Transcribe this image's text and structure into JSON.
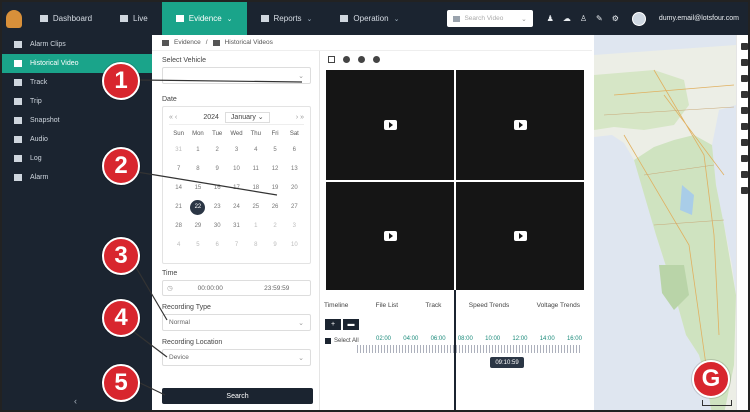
{
  "topbar": {
    "nav": [
      {
        "label": "Dashboard",
        "icon": "dashboard-icon",
        "active": false
      },
      {
        "label": "Live",
        "icon": "live-icon",
        "active": false
      },
      {
        "label": "Evidence",
        "icon": "evidence-icon",
        "active": true
      },
      {
        "label": "Reports",
        "icon": "reports-icon",
        "active": false
      },
      {
        "label": "Operation",
        "icon": "operation-icon",
        "active": false
      }
    ],
    "search_placeholder": "Search Video",
    "email": "dumy.email@lotsfour.com"
  },
  "sidebar": {
    "items": [
      {
        "label": "Alarm Clips",
        "icon": "alarm-clips-icon"
      },
      {
        "label": "Historical Video",
        "icon": "historical-video-icon",
        "active": true
      },
      {
        "label": "Track",
        "icon": "track-icon"
      },
      {
        "label": "Trip",
        "icon": "trip-icon"
      },
      {
        "label": "Snapshot",
        "icon": "snapshot-icon"
      },
      {
        "label": "Audio",
        "icon": "audio-icon"
      },
      {
        "label": "Log",
        "icon": "log-icon"
      },
      {
        "label": "Alarm",
        "icon": "alarm-icon"
      }
    ],
    "collapse": "‹"
  },
  "breadcrumb": {
    "root": "Evidence",
    "sep": "/",
    "current": "Historical Videos"
  },
  "form": {
    "vehicle_label": "Select Vehicle",
    "date_label": "Date",
    "calendar": {
      "year": "2024",
      "month": "January",
      "weekdays": [
        "Sun",
        "Mon",
        "Tue",
        "Wed",
        "Thu",
        "Fri",
        "Sat"
      ],
      "days": [
        "31",
        "1",
        "2",
        "3",
        "4",
        "5",
        "6",
        "7",
        "8",
        "9",
        "10",
        "11",
        "12",
        "13",
        "14",
        "15",
        "16",
        "17",
        "18",
        "19",
        "20",
        "21",
        "22",
        "23",
        "24",
        "25",
        "26",
        "27",
        "28",
        "29",
        "30",
        "31",
        "1",
        "2",
        "3",
        "4",
        "5",
        "6",
        "7",
        "8",
        "9",
        "10"
      ],
      "selected_day": "22"
    },
    "time_label": "Time",
    "time_start": "00:00:00",
    "time_end": "23:59:59",
    "recording_type_label": "Recording Type",
    "recording_type_value": "Normal",
    "recording_location_label": "Recording Location",
    "recording_location_value": "Device",
    "search_button": "Search"
  },
  "timeline": {
    "tabs": [
      "Timeline",
      "File List",
      "Track",
      "Speed Trends",
      "Voltage Trends"
    ],
    "add_button": "+",
    "select_all": "Select All",
    "hours": [
      "02:00",
      "04:00",
      "06:00",
      "08:00",
      "10:00",
      "12:00",
      "14:00",
      "16:00"
    ],
    "cursor_time": "09:10:59"
  },
  "callouts": [
    "1",
    "2",
    "3",
    "4",
    "5",
    "G"
  ],
  "colors": {
    "nav_bg": "#1b2430",
    "accent": "#1aa48a",
    "callout": "#d8262e"
  }
}
